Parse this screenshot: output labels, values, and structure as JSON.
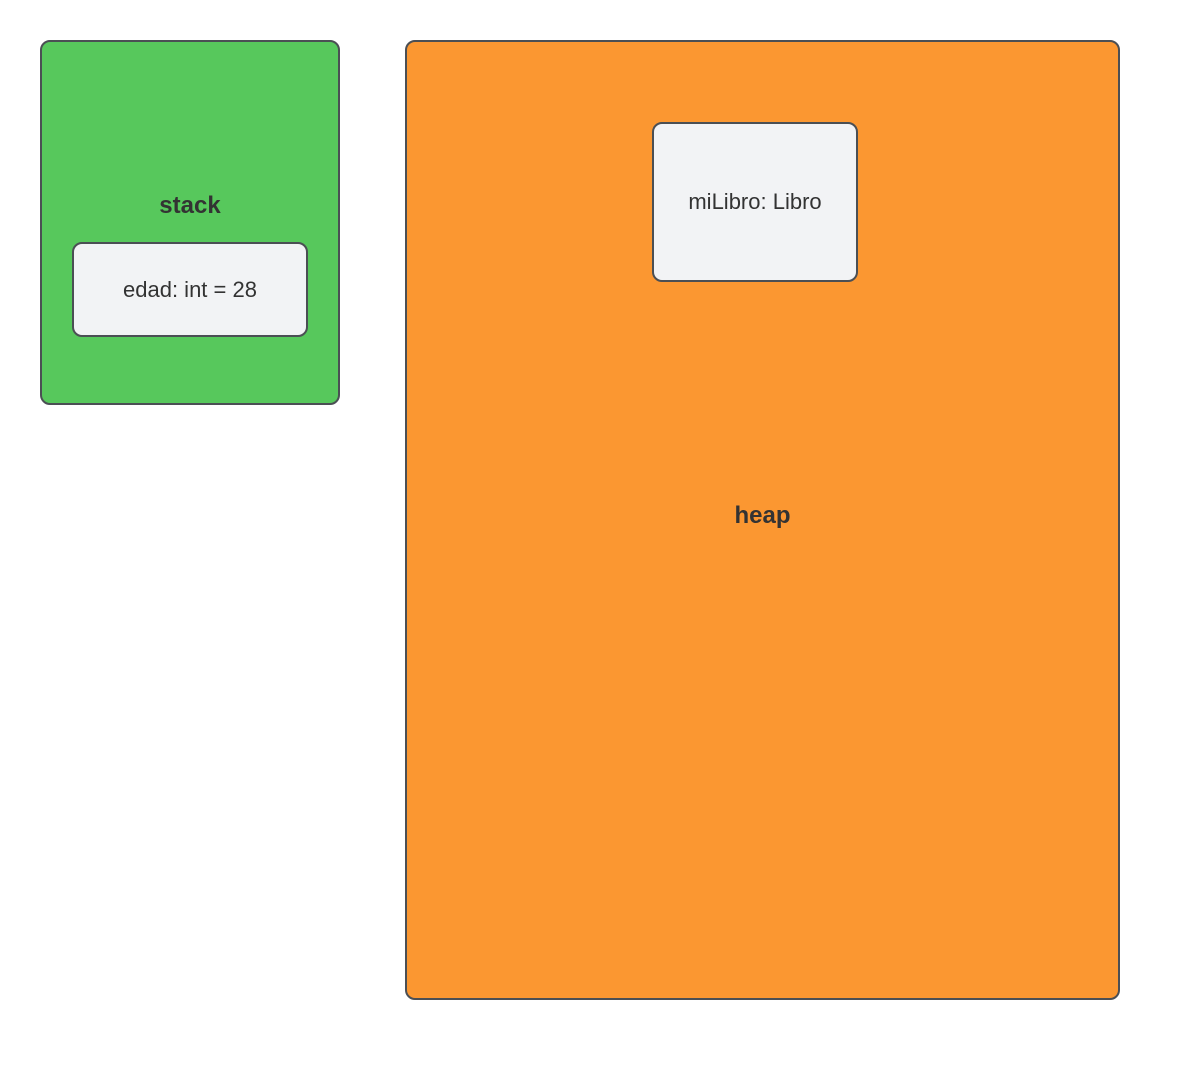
{
  "stack": {
    "title": "stack",
    "color": "#57c85c",
    "entries": [
      {
        "name": "edad",
        "type": "int",
        "value": 28,
        "display": "edad: int = 28"
      }
    ]
  },
  "heap": {
    "title": "heap",
    "color": "#fb9731",
    "entries": [
      {
        "name": "miLibro",
        "type": "Libro",
        "display": "miLibro: Libro"
      }
    ]
  }
}
